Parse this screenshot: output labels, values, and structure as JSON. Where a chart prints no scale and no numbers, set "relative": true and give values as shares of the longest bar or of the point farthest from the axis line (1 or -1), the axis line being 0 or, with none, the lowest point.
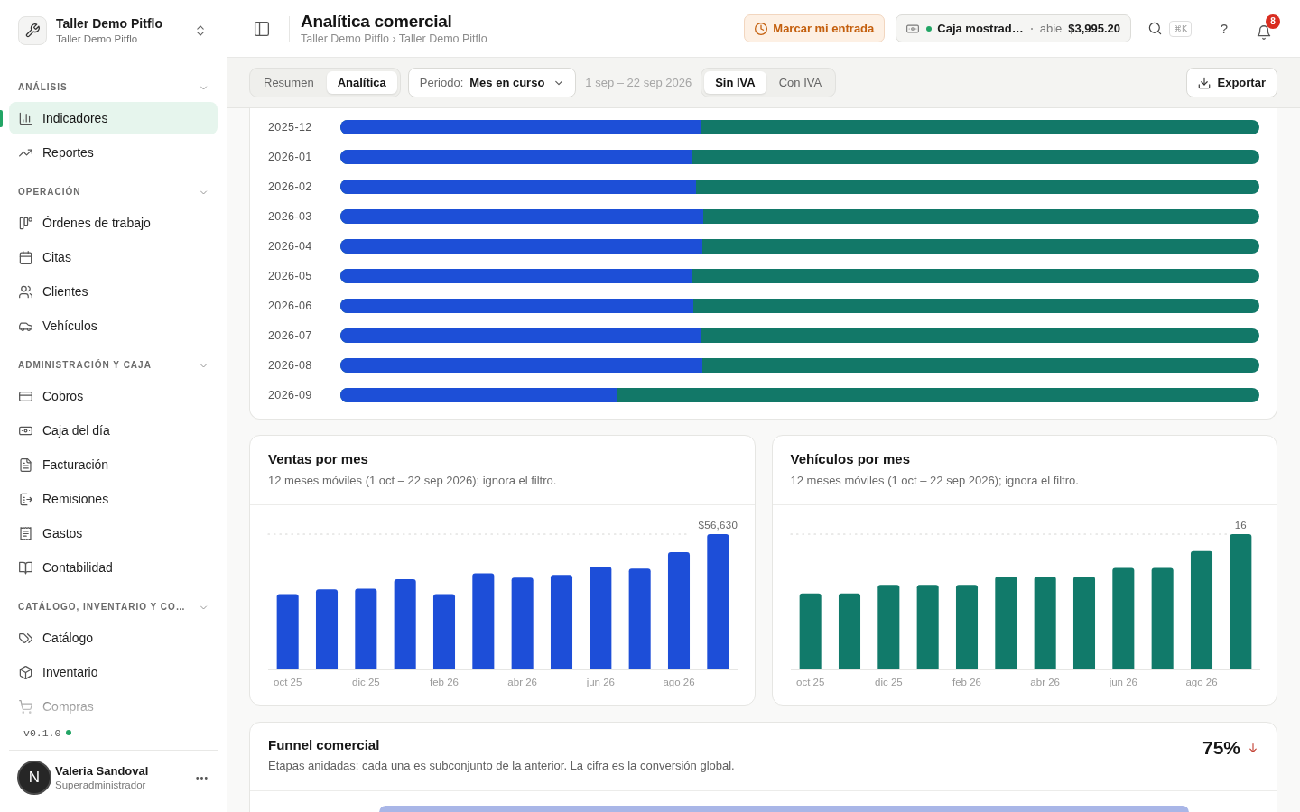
{
  "sidebar": {
    "workspace": {
      "name": "Taller Demo Pitflo",
      "subtitle": "Taller Demo Pitflo"
    },
    "sections": [
      {
        "title": "ANÁLISIS",
        "expanded": true,
        "items": [
          {
            "label": "Indicadores",
            "selected": true
          },
          {
            "label": "Reportes",
            "selected": false
          }
        ]
      },
      {
        "title": "OPERACIÓN",
        "expanded": true,
        "items": [
          {
            "label": "Órdenes de trabajo",
            "selected": false
          },
          {
            "label": "Citas",
            "selected": false
          },
          {
            "label": "Clientes",
            "selected": false
          },
          {
            "label": "Vehículos",
            "selected": false
          }
        ]
      },
      {
        "title": "ADMINISTRACIÓN Y CAJA",
        "expanded": true,
        "items": [
          {
            "label": "Cobros",
            "selected": false
          },
          {
            "label": "Caja del día",
            "selected": false
          },
          {
            "label": "Facturación",
            "selected": false
          },
          {
            "label": "Remisiones",
            "selected": false
          },
          {
            "label": "Gastos",
            "selected": false
          },
          {
            "label": "Contabilidad",
            "selected": false
          }
        ]
      },
      {
        "title": "CATÁLOGO, INVENTARIO Y CO…",
        "expanded": true,
        "items": [
          {
            "label": "Catálogo",
            "selected": false
          },
          {
            "label": "Inventario",
            "selected": false
          },
          {
            "label": "Compras",
            "selected": false
          }
        ]
      }
    ],
    "version": "v0.1.0",
    "user": {
      "initial": "N",
      "name": "Valeria Sandoval",
      "role": "Superadministrador"
    }
  },
  "header": {
    "title": "Analítica comercial",
    "breadcrumb": "Taller Demo Pitflo › Taller Demo Pitflo",
    "clock_in_button": "Marcar mi entrada",
    "cash_register": {
      "open": true,
      "name": "Caja mostrad…",
      "status": "abie",
      "amount": "$3,995.20"
    },
    "search_shortcut": "⌘K",
    "help": "?",
    "notification_count": "8"
  },
  "toolbar": {
    "view_tabs": [
      {
        "label": "Resumen",
        "selected": false
      },
      {
        "label": "Analítica",
        "selected": true
      }
    ],
    "period": {
      "label": "Periodo:",
      "value": "Mes en curso"
    },
    "date_range": "1 sep – 22 sep 2026",
    "tax_tabs": [
      {
        "label": "Sin IVA",
        "selected": true
      },
      {
        "label": "Con IVA",
        "selected": false
      }
    ],
    "export_button": "Exportar"
  },
  "monthly_split": {
    "rows": [
      {
        "label": "2025-12",
        "level": 0.393
      },
      {
        "label": "2026-01",
        "level": 0.383
      },
      {
        "label": "2026-02",
        "level": 0.387
      },
      {
        "label": "2026-03",
        "level": 0.395
      },
      {
        "label": "2026-04",
        "level": 0.394
      },
      {
        "label": "2026-05",
        "level": 0.383
      },
      {
        "label": "2026-06",
        "level": 0.384
      },
      {
        "label": "2026-07",
        "level": 0.392
      },
      {
        "label": "2026-08",
        "level": 0.394
      },
      {
        "label": "2026-09",
        "level": 0.302
      }
    ]
  },
  "sales_chart": {
    "title": "Ventas por mes",
    "subtitle": "12 meses móviles (1 oct – 22 sep 2026); ignora el filtro.",
    "chart_data": {
      "type": "bar",
      "relative": true,
      "categories": [
        "oct 25",
        null,
        "dic 25",
        null,
        "feb 26",
        null,
        "abr 26",
        null,
        "jun 26",
        null,
        "ago 26",
        null
      ],
      "series": [
        {
          "color": "#1d4ed8",
          "values": [
            0.556,
            0.592,
            0.597,
            0.666,
            0.556,
            0.71,
            0.678,
            0.698,
            0.758,
            0.745,
            0.867,
            1
          ]
        }
      ],
      "value_labels": [
        null,
        null,
        null,
        null,
        null,
        null,
        null,
        null,
        null,
        null,
        null,
        "$56,630"
      ]
    }
  },
  "vehicles_chart": {
    "title": "Vehículos por mes",
    "subtitle": "12 meses móviles (1 oct – 22 sep 2026); ignora el filtro.",
    "chart_data": {
      "type": "bar",
      "relative": true,
      "categories": [
        "oct 25",
        null,
        "dic 25",
        null,
        "feb 26",
        null,
        "abr 26",
        null,
        "jun 26",
        null,
        "ago 26",
        null
      ],
      "series": [
        {
          "color": "#117a6a",
          "values": [
            0.5625,
            0.5625,
            0.625,
            0.625,
            0.625,
            0.6875,
            0.6875,
            0.6875,
            0.75,
            0.75,
            0.875,
            1
          ]
        }
      ],
      "value_labels": [
        null,
        null,
        null,
        null,
        null,
        null,
        null,
        null,
        null,
        null,
        null,
        "16"
      ]
    }
  },
  "funnel": {
    "title": "Funnel comercial",
    "subtitle": "Etapas anidadas: cada una es subconjunto de la anterior. La cifra es la conversión global.",
    "conversion": "75%",
    "falling": true,
    "stages": [
      {
        "level": 1
      }
    ]
  }
}
